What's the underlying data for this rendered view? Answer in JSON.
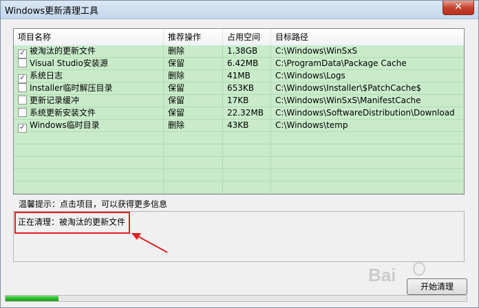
{
  "window": {
    "title": "Windows更新清理工具",
    "close_label": "✕"
  },
  "listview": {
    "columns": [
      "项目名称",
      "推荐操作",
      "占用空间",
      "目标路径"
    ],
    "rows": [
      {
        "checked": true,
        "name": "被淘汰的更新文件",
        "action": "删除",
        "size": "1.38GB",
        "path": "C:\\Windows\\WinSxS"
      },
      {
        "checked": false,
        "name": "Visual Studio安装源",
        "action": "保留",
        "size": "6.42MB",
        "path": "C:\\ProgramData\\Package Cache"
      },
      {
        "checked": true,
        "name": "系统日志",
        "action": "删除",
        "size": "41MB",
        "path": "C:\\Windows\\Logs"
      },
      {
        "checked": false,
        "name": "Installer临时解压目录",
        "action": "保留",
        "size": "653KB",
        "path": "C:\\Windows\\Installer\\$PatchCache$"
      },
      {
        "checked": false,
        "name": "更新记录缓冲",
        "action": "保留",
        "size": "17KB",
        "path": "C:\\Windows\\WinSxS\\ManifestCache"
      },
      {
        "checked": false,
        "name": "系统更新安装文件",
        "action": "保留",
        "size": "22.32MB",
        "path": "C:\\Windows\\SoftwareDistribution\\Download"
      },
      {
        "checked": true,
        "name": "Windows临时目录",
        "action": "删除",
        "size": "43KB",
        "path": "C:\\Windows\\temp"
      }
    ]
  },
  "hint": "温馨提示：点击项目，可以获得更多信息",
  "status": "正在清理：被淘汰的更新文件",
  "buttons": {
    "start": "开始清理"
  },
  "progress": {
    "fraction": 0.115
  },
  "colors": {
    "row_bg": "#c9ebca",
    "highlight": "#e02020",
    "progress": "#2cb82c"
  }
}
